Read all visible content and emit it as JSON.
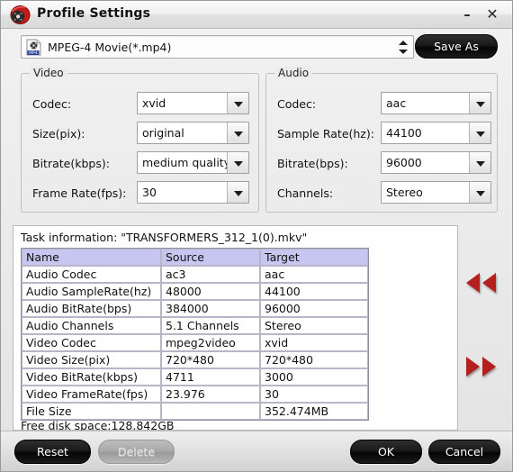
{
  "window": {
    "title": "Profile Settings",
    "app_icon": "disc-app-icon",
    "minimize_label": "–",
    "close_label": "✕"
  },
  "profile": {
    "icon": "mp4-file-icon",
    "selected": "MPEG-4 Movie(*.mp4)",
    "save_as_label": "Save As"
  },
  "video": {
    "legend": "Video",
    "fields": [
      {
        "label": "Codec:",
        "value": "xvid"
      },
      {
        "label": "Size(pix):",
        "value": "original"
      },
      {
        "label": "Bitrate(kbps):",
        "value": "medium quality"
      },
      {
        "label": "Frame Rate(fps):",
        "value": "30"
      }
    ]
  },
  "audio": {
    "legend": "Audio",
    "fields": [
      {
        "label": "Codec:",
        "value": "aac"
      },
      {
        "label": "Sample Rate(hz):",
        "value": "44100"
      },
      {
        "label": "Bitrate(bps):",
        "value": "96000"
      },
      {
        "label": "Channels:",
        "value": "Stereo"
      }
    ]
  },
  "task": {
    "title": "Task information: \"TRANSFORMERS_312_1(0).mkv\"",
    "columns": [
      "Name",
      "Source",
      "Target"
    ],
    "rows": [
      [
        "Audio Codec",
        "ac3",
        "aac"
      ],
      [
        "Audio SampleRate(hz)",
        "48000",
        "44100"
      ],
      [
        "Audio BitRate(bps)",
        "384000",
        "96000"
      ],
      [
        "Audio Channels",
        "5.1 Channels",
        "Stereo"
      ],
      [
        "Video Codec",
        "mpeg2video",
        "xvid"
      ],
      [
        "Video Size(pix)",
        "720*480",
        "720*480"
      ],
      [
        "Video BitRate(kbps)",
        "4711",
        "3000"
      ],
      [
        "Video FrameRate(fps)",
        "23.976",
        "30"
      ],
      [
        "File Size",
        "",
        "352.474MB"
      ]
    ],
    "disk_space": "Free disk space:128.842GB"
  },
  "nav": {
    "prev_icon": "double-left-arrow-icon",
    "next_icon": "double-right-arrow-icon"
  },
  "footer": {
    "reset_label": "Reset",
    "delete_label": "Delete",
    "ok_label": "OK",
    "cancel_label": "Cancel"
  },
  "colors": {
    "table_header": "#c6c6f0",
    "arrow_red": "#b42020",
    "panel_bg": "#ececec"
  }
}
